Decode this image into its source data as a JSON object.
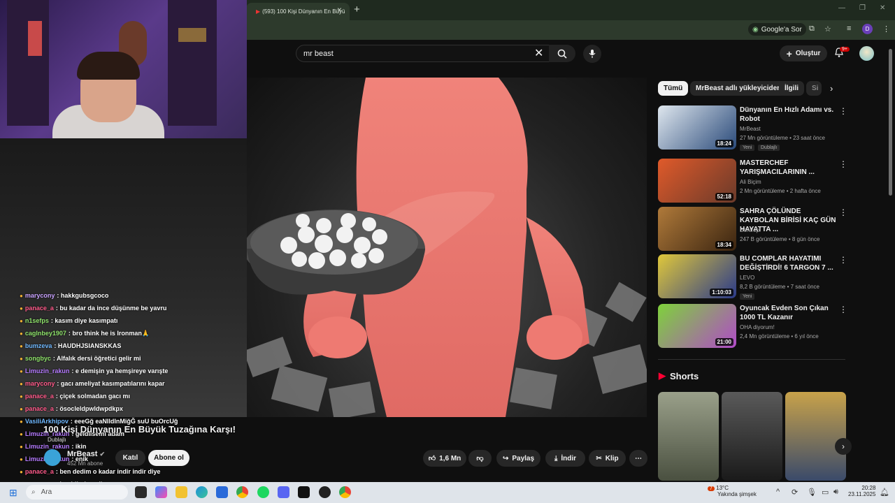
{
  "browser": {
    "tab_title": "(593) 100 Kişi Dünyanın En Büyü",
    "tab_close": "×",
    "new_tab": "+",
    "ask_google": "Google'a Sor",
    "profile_letter": "D",
    "win_min": "—",
    "win_restore": "❐",
    "win_close": "✕"
  },
  "header": {
    "search_value": "mr beast",
    "clear": "✕",
    "search_icon": "⌕",
    "mic_icon": "🎤",
    "create_label": "Oluştur",
    "create_plus": "+",
    "notif_badge": "9+",
    "bell": "🔔"
  },
  "video": {
    "title": "100 Kişi Dünyanın En Büyük Tuzağına Karşı!",
    "dub_label": "Dublajlı",
    "channel": "MrBeast",
    "subscribers": "452 Mn abone",
    "join_label": "Katıl",
    "subscribe_label": "Abone ol",
    "likes": "1,6 Mn",
    "share_label": "Paylaş",
    "download_label": "İndir",
    "clip_label": "Klip",
    "more": "⋯"
  },
  "chat": [
    {
      "user": "marycony",
      "msg": ": hakkgubsgcoco",
      "color": "#c8a2ff"
    },
    {
      "user": "panace_a",
      "msg": ": bu kadar da ince düşünme be yavru",
      "color": "#ff5a8a"
    },
    {
      "user": "n1sefps",
      "msg": ": kasım diye kasımpatı",
      "color": "#8fe36b"
    },
    {
      "user": "caglnbey1907",
      "msg": ": bro think he is Ironman🙏",
      "color": "#8fe36b"
    },
    {
      "user": "bumzeva",
      "msg": ": HAUDHJSIANSKKAS",
      "color": "#6fb8ff"
    },
    {
      "user": "songbyc",
      "msg": ": Alfalık dersi öğretici gelir mi",
      "color": "#8fe36b"
    },
    {
      "user": "Limuzin_rakun",
      "msg": ": e demişin ya hemşireye varışte",
      "color": "#b57bff"
    },
    {
      "user": "marycony",
      "msg": ": gacı ameliyat kasımpatılarını kapar",
      "color": "#ff5a8a"
    },
    {
      "user": "panace_a",
      "msg": ": çiçek solmadan gacı mı",
      "color": "#ff5a8a"
    },
    {
      "user": "panace_a",
      "msg": ": ösocleldpwldwpdkpx",
      "color": "#ff5a8a"
    },
    {
      "user": "VasiliArkhipov",
      "msg": ": eeeGğ eaNIldInMiğĞ suU buOrcUğ",
      "color": "#6fb8ff"
    },
    {
      "user": "Limuzin_rakun",
      "msg": ": geldiisemi adam",
      "color": "#b57bff"
    },
    {
      "user": "Limuzin_rakun",
      "msg": ": ikin",
      "color": "#b57bff"
    },
    {
      "user": "Limuzin_rakun",
      "msg": ": enik",
      "color": "#b57bff"
    },
    {
      "user": "panace_a",
      "msg": ": ben dedim o kadar indir indir diye",
      "color": "#ff5a8a"
    },
    {
      "user": "panace_a",
      "msg": ": benidindenedi",
      "color": "#ff5a8a"
    }
  ],
  "chips": [
    "Tümü",
    "MrBeast adlı yükleyiciden",
    "İlgili",
    "Si"
  ],
  "recommendations": [
    {
      "title": "Dünyanın En Hızlı Adamı vs. Robot",
      "channel": "MrBeast",
      "meta": "27 Mn görüntüleme • 23 saat önce",
      "badges": [
        "Yeni",
        "Dublajlı"
      ],
      "duration": "18:24",
      "c1": "#dfe7ee",
      "c2": "#2a4a7a"
    },
    {
      "title": "MASTERCHEF YARIŞMACILARININ ...",
      "channel": "Ali Biçim",
      "meta": "2 Mn görüntüleme • 2 hafta önce",
      "badges": [],
      "duration": "52:18",
      "c1": "#e05a2a",
      "c2": "#6a3a2a"
    },
    {
      "title": "SAHRA ÇÖLÜNDE KAYBOLAN BİRİSİ KAÇ GÜN HAYATTA ...",
      "channel": "Bentropi",
      "meta": "247 B görüntüleme • 8 gün önce",
      "badges": [],
      "duration": "18:34",
      "c1": "#b07a3a",
      "c2": "#3a2410"
    },
    {
      "title": "BU COMPLAR HAYATIMI DEĞİŞTİRDİ! 6 TARGON 7 ...",
      "channel": "LEVO",
      "meta": "8,2 B görüntüleme • 7 saat önce",
      "badges": [
        "Yeni"
      ],
      "duration": "1:10:03",
      "c1": "#e0c83a",
      "c2": "#2a3a8a"
    },
    {
      "title": "Oyuncak Evden Son Çıkan 1000 TL Kazanır",
      "channel": "OHA diyorum!",
      "meta": "2,4 Mn görüntüleme • 6 yıl önce",
      "badges": [],
      "duration": "21:00",
      "c1": "#7ed23a",
      "c2": "#b04ac8"
    }
  ],
  "shorts": {
    "label": "Shorts",
    "items": [
      {
        "c1": "#9aa08a",
        "c2": "#4a5040"
      },
      {
        "c1": "#5a5a5a",
        "c2": "#1a1a1a"
      },
      {
        "c1": "#c8a24a",
        "c2": "#3a4a6a"
      }
    ]
  },
  "taskbar": {
    "search_label": "Ara",
    "weather_temp": "13°C",
    "weather_desc": "Yakında şimşek",
    "weather_badge": "7",
    "time": "20:28",
    "date": "23.11.2025"
  }
}
